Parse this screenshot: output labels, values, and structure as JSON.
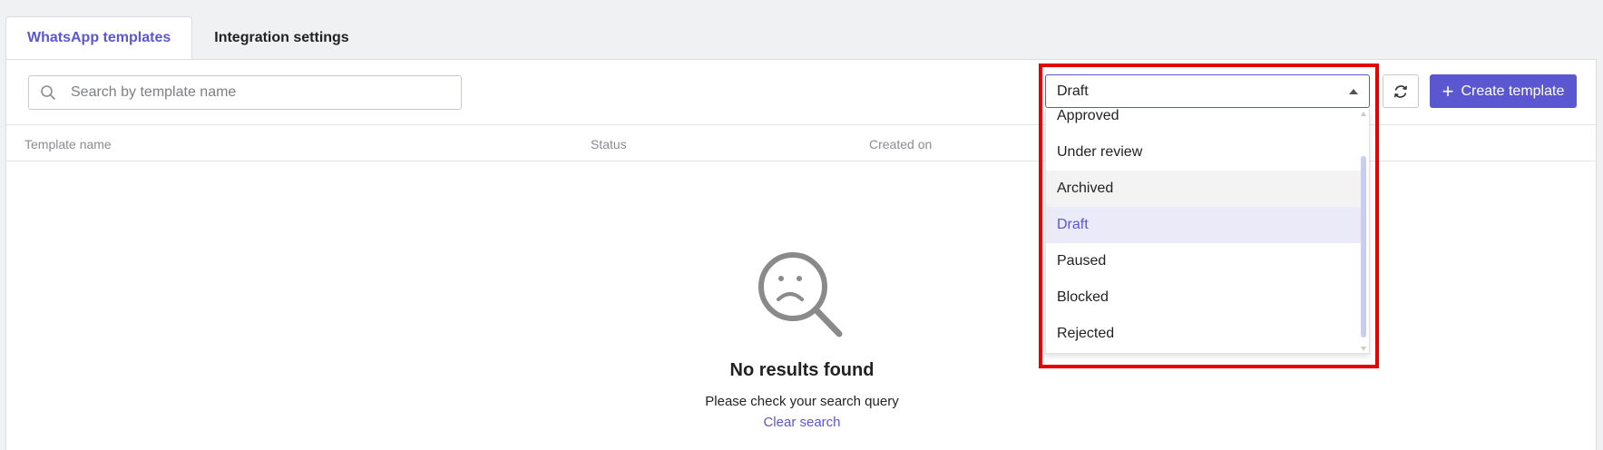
{
  "tabs": [
    {
      "label": "WhatsApp templates",
      "active": true
    },
    {
      "label": "Integration settings",
      "active": false
    }
  ],
  "search": {
    "placeholder": "Search by template name",
    "value": ""
  },
  "table": {
    "columns": [
      "Template name",
      "Status",
      "Created on"
    ]
  },
  "empty_state": {
    "icon": "sad-magnifier-icon",
    "title": "No results found",
    "subtitle": "Please check your search query",
    "link": "Clear search"
  },
  "status_filter": {
    "selected": "Draft",
    "options": [
      "Approved",
      "Under review",
      "Archived",
      "Draft",
      "Paused",
      "Blocked",
      "Rejected"
    ],
    "hovered": "Archived"
  },
  "toolbar": {
    "refresh_icon": "refresh-icon",
    "create_label": "Create template"
  },
  "colors": {
    "accent": "#5b57d1",
    "highlight": "#e60000",
    "background": "#f0f1f3"
  }
}
